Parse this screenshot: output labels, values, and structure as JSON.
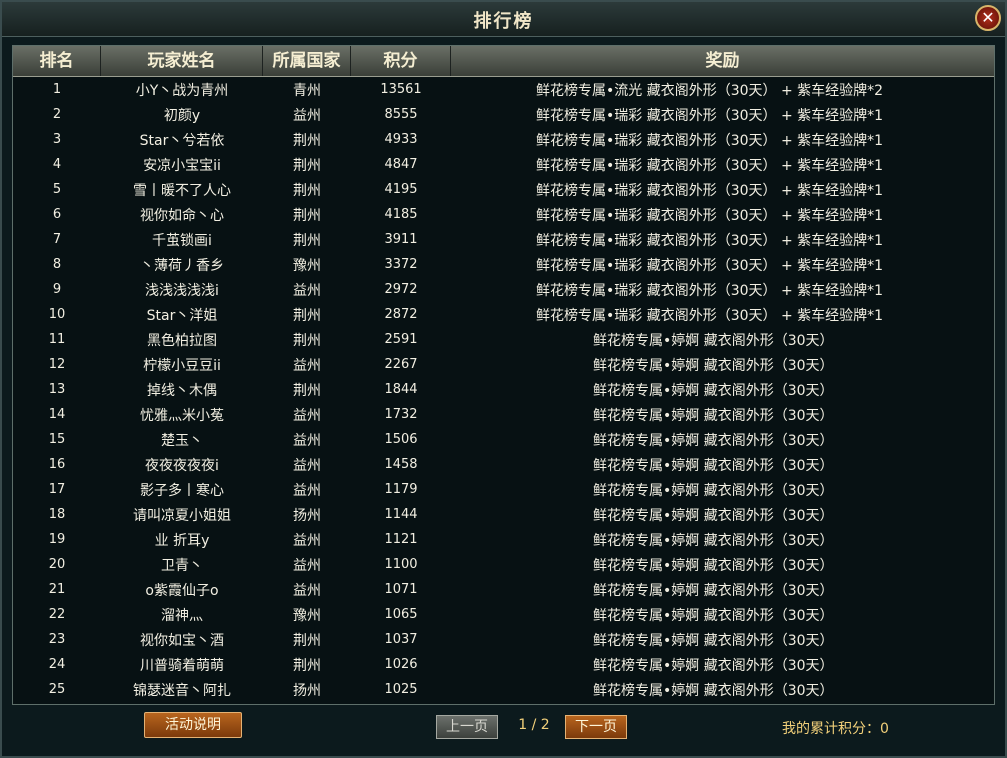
{
  "window": {
    "title": "排行榜",
    "close_label": "✕"
  },
  "table": {
    "columns": [
      "排名",
      "玩家姓名",
      "所属国家",
      "积分",
      "奖励"
    ],
    "rows": [
      {
        "rank": "1",
        "name": "小Y丶战为青州",
        "country": "青州",
        "score": "13561",
        "reward": "鲜花榜专属•流光 藏衣阁外形（30天） + 紫车经验牌*2"
      },
      {
        "rank": "2",
        "name": "初颜y",
        "country": "益州",
        "score": "8555",
        "reward": "鲜花榜专属•瑞彩 藏衣阁外形（30天） + 紫车经验牌*1"
      },
      {
        "rank": "3",
        "name": "Star丶兮若依",
        "country": "荆州",
        "score": "4933",
        "reward": "鲜花榜专属•瑞彩 藏衣阁外形（30天） + 紫车经验牌*1"
      },
      {
        "rank": "4",
        "name": "安凉小宝宝ii",
        "country": "荆州",
        "score": "4847",
        "reward": "鲜花榜专属•瑞彩 藏衣阁外形（30天） + 紫车经验牌*1"
      },
      {
        "rank": "5",
        "name": "雪丨暖不了人心",
        "country": "荆州",
        "score": "4195",
        "reward": "鲜花榜专属•瑞彩 藏衣阁外形（30天） + 紫车经验牌*1"
      },
      {
        "rank": "6",
        "name": "视你如命丶心",
        "country": "荆州",
        "score": "4185",
        "reward": "鲜花榜专属•瑞彩 藏衣阁外形（30天） + 紫车经验牌*1"
      },
      {
        "rank": "7",
        "name": "千茧锁画i",
        "country": "荆州",
        "score": "3911",
        "reward": "鲜花榜专属•瑞彩 藏衣阁外形（30天） + 紫车经验牌*1"
      },
      {
        "rank": "8",
        "name": "丶薄荷丿香乡",
        "country": "豫州",
        "score": "3372",
        "reward": "鲜花榜专属•瑞彩 藏衣阁外形（30天） + 紫车经验牌*1"
      },
      {
        "rank": "9",
        "name": "浅浅浅浅浅i",
        "country": "益州",
        "score": "2972",
        "reward": "鲜花榜专属•瑞彩 藏衣阁外形（30天） + 紫车经验牌*1"
      },
      {
        "rank": "10",
        "name": "Star丶洋姐",
        "country": "荆州",
        "score": "2872",
        "reward": "鲜花榜专属•瑞彩 藏衣阁外形（30天） + 紫车经验牌*1"
      },
      {
        "rank": "11",
        "name": "黑色柏拉图",
        "country": "荆州",
        "score": "2591",
        "reward": "鲜花榜专属•婷婀 藏衣阁外形（30天）"
      },
      {
        "rank": "12",
        "name": "柠檬小豆豆ii",
        "country": "益州",
        "score": "2267",
        "reward": "鲜花榜专属•婷婀 藏衣阁外形（30天）"
      },
      {
        "rank": "13",
        "name": "掉线丶木偶",
        "country": "荆州",
        "score": "1844",
        "reward": "鲜花榜专属•婷婀 藏衣阁外形（30天）"
      },
      {
        "rank": "14",
        "name": "忧雅灬米小菟",
        "country": "益州",
        "score": "1732",
        "reward": "鲜花榜专属•婷婀 藏衣阁外形（30天）"
      },
      {
        "rank": "15",
        "name": "楚玉丶",
        "country": "益州",
        "score": "1506",
        "reward": "鲜花榜专属•婷婀 藏衣阁外形（30天）"
      },
      {
        "rank": "16",
        "name": "夜夜夜夜夜i",
        "country": "益州",
        "score": "1458",
        "reward": "鲜花榜专属•婷婀 藏衣阁外形（30天）"
      },
      {
        "rank": "17",
        "name": "影子多丨寒心",
        "country": "益州",
        "score": "1179",
        "reward": "鲜花榜专属•婷婀 藏衣阁外形（30天）"
      },
      {
        "rank": "18",
        "name": "请叫凉夏小姐姐",
        "country": "扬州",
        "score": "1144",
        "reward": "鲜花榜专属•婷婀 藏衣阁外形（30天）"
      },
      {
        "rank": "19",
        "name": "业 折耳y",
        "country": "益州",
        "score": "1121",
        "reward": "鲜花榜专属•婷婀 藏衣阁外形（30天）"
      },
      {
        "rank": "20",
        "name": "卫青丶",
        "country": "益州",
        "score": "1100",
        "reward": "鲜花榜专属•婷婀 藏衣阁外形（30天）"
      },
      {
        "rank": "21",
        "name": "o紫霞仙子o",
        "country": "益州",
        "score": "1071",
        "reward": "鲜花榜专属•婷婀 藏衣阁外形（30天）"
      },
      {
        "rank": "22",
        "name": "溜神灬",
        "country": "豫州",
        "score": "1065",
        "reward": "鲜花榜专属•婷婀 藏衣阁外形（30天）"
      },
      {
        "rank": "23",
        "name": "视你如宝丶酒",
        "country": "荆州",
        "score": "1037",
        "reward": "鲜花榜专属•婷婀 藏衣阁外形（30天）"
      },
      {
        "rank": "24",
        "name": "川普骑着萌萌",
        "country": "荆州",
        "score": "1026",
        "reward": "鲜花榜专属•婷婀 藏衣阁外形（30天）"
      },
      {
        "rank": "25",
        "name": "锦瑟迷音丶阿扎",
        "country": "扬州",
        "score": "1025",
        "reward": "鲜花榜专属•婷婀 藏衣阁外形（30天）"
      }
    ]
  },
  "footer": {
    "event_button": "活动说明",
    "prev_button": "上一页",
    "next_button": "下一页",
    "page_indicator": "1 / 2",
    "my_score": "我的累计积分：0"
  },
  "colors": {
    "text": "#f2efe2",
    "accent_gold": "#f2d07a",
    "button_orange": "#b8651e"
  }
}
